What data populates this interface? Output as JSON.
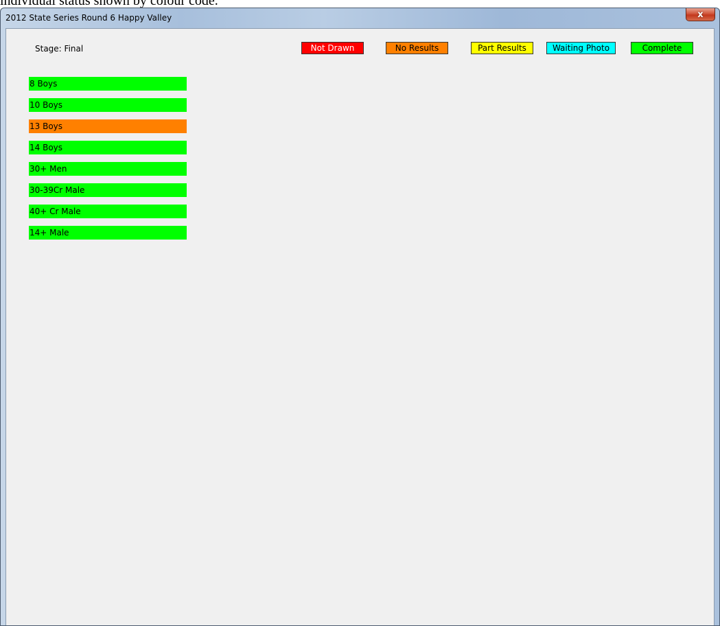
{
  "caption": "individual status shown by colour code.",
  "window": {
    "title": "2012 State Series Round 6 Happy Valley",
    "close_symbol": "x"
  },
  "stage": {
    "label": "Stage: Final"
  },
  "legend": [
    {
      "label": "Not Drawn",
      "color": "#ff0000",
      "text_color": "#ffffff"
    },
    {
      "label": "No Results",
      "color": "#ff8000",
      "text_color": "#000000"
    },
    {
      "label": "Part Results",
      "color": "#ffff00",
      "text_color": "#000000"
    },
    {
      "label": "Waiting Photo",
      "color": "#00ffff",
      "text_color": "#000000"
    },
    {
      "label": "Complete",
      "color": "#00ff00",
      "text_color": "#000000"
    }
  ],
  "events": [
    {
      "label": "8 Boys",
      "status": "Complete",
      "color": "#00ff00"
    },
    {
      "label": "10 Boys",
      "status": "Complete",
      "color": "#00ff00"
    },
    {
      "label": "13 Boys",
      "status": "No Results",
      "color": "#ff8000"
    },
    {
      "label": "14 Boys",
      "status": "Complete",
      "color": "#00ff00"
    },
    {
      "label": "30+ Men",
      "status": "Complete",
      "color": "#00ff00"
    },
    {
      "label": "30-39Cr Male",
      "status": "Complete",
      "color": "#00ff00"
    },
    {
      "label": "40+ Cr Male",
      "status": "Complete",
      "color": "#00ff00"
    },
    {
      "label": "14+ Male",
      "status": "Complete",
      "color": "#00ff00"
    }
  ]
}
